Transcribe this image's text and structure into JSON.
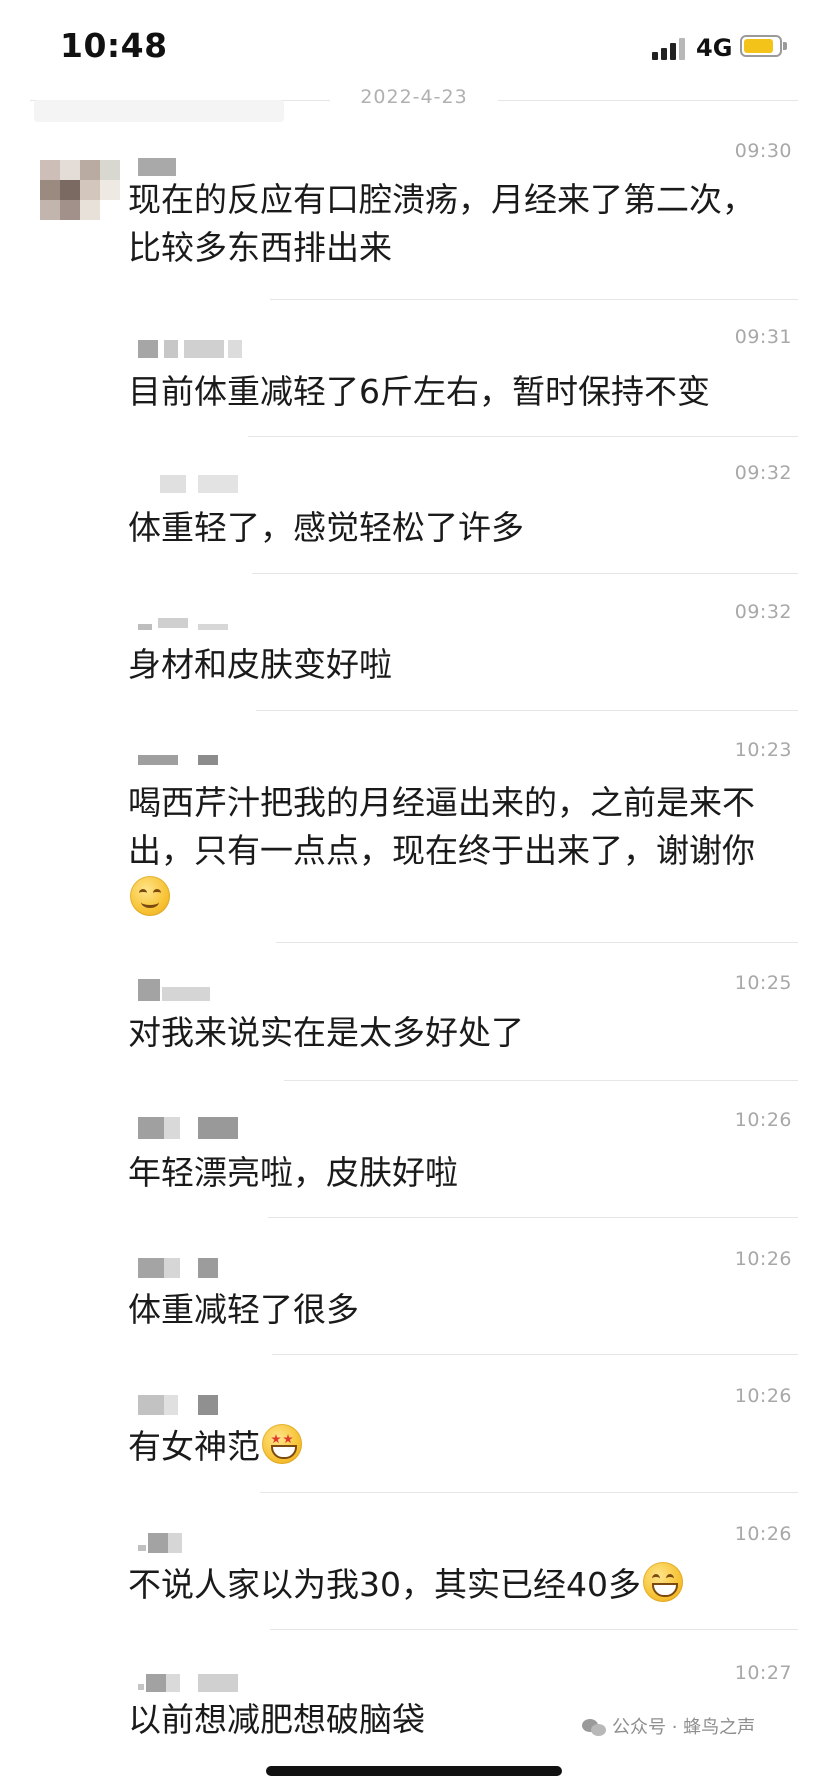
{
  "status_bar": {
    "time": "10:48",
    "network": "4G",
    "battery_level": 0.85,
    "battery_color": "#f3c31a"
  },
  "date_divider": "2022-4-23",
  "messages": [
    {
      "time": "09:30",
      "text": "现在的反应有口腔溃疡，月经来了第二次，比较多东西排出来",
      "emoji": ""
    },
    {
      "time": "09:31",
      "text": "目前体重减轻了6斤左右，暂时保持不变",
      "emoji": ""
    },
    {
      "time": "09:32",
      "text": "体重轻了，感觉轻松了许多",
      "emoji": ""
    },
    {
      "time": "09:32",
      "text": "身材和皮肤变好啦",
      "emoji": ""
    },
    {
      "time": "10:23",
      "text": "喝西芹汁把我的月经逼出来的，之前是来不出，只有一点点，现在终于出来了，谢谢你",
      "emoji": "smiling-face-icon"
    },
    {
      "time": "10:25",
      "text": "对我来说实在是太多好处了",
      "emoji": ""
    },
    {
      "time": "10:26",
      "text": "年轻漂亮啦，皮肤好啦",
      "emoji": ""
    },
    {
      "time": "10:26",
      "text": "体重减轻了很多",
      "emoji": ""
    },
    {
      "time": "10:26",
      "text": "有女神范",
      "emoji": "star-struck-icon"
    },
    {
      "time": "10:26",
      "text": "不说人家以为我30，其实已经40多",
      "emoji": "grinning-face-icon"
    },
    {
      "time": "10:27",
      "text": "以前想减肥想破脑袋",
      "emoji": ""
    }
  ],
  "watermark": {
    "text": "公众号 · 蜂鸟之声",
    "icon": "wechat-icon"
  },
  "colors": {
    "text": "#1a1a1a",
    "timestamp": "#a8a8a8",
    "divider": "#e6e6e6"
  }
}
